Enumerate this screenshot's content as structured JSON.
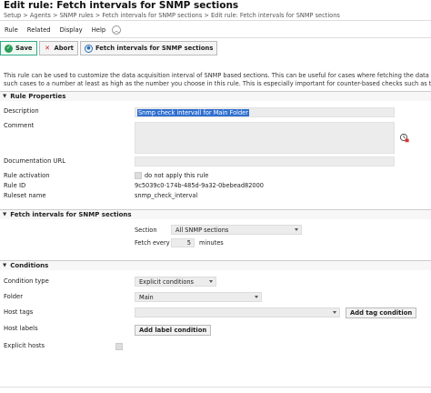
{
  "page": {
    "title": "Edit rule: Fetch intervals for SNMP sections",
    "breadcrumb": "Setup > Agents > SNMP rules > Fetch intervals for SNMP sections > Edit rule: Fetch intervals for SNMP sections"
  },
  "menu": {
    "items": [
      "Rule",
      "Related",
      "Display",
      "Help"
    ],
    "toggle_icon": "chevron-up-icon"
  },
  "toolbar": {
    "save_label": "Save",
    "abort_label": "Abort",
    "fetch_label": "Fetch intervals for SNMP sections"
  },
  "intro": {
    "line1": "This rule can be used to customize the data acquisition interval of SNMP based sections. This can be useful for cases where fetching the data takes",
    "line2": "such cases to a number at least as high as the number you choose in this rule. This is especially important for counter-based checks such as the"
  },
  "rule_properties": {
    "heading": "Rule Properties",
    "description_label": "Description",
    "description_value": "Snmp check intervall for Main Folder",
    "comment_label": "Comment",
    "comment_value": "",
    "doc_url_label": "Documentation URL",
    "doc_url_value": "",
    "activation_label": "Rule activation",
    "activation_text": "do not apply this rule",
    "rule_id_label": "Rule ID",
    "rule_id_value": "9c5039c0-174b-485d-9a32-0bebead82000",
    "ruleset_label": "Ruleset name",
    "ruleset_value": "snmp_check_interval"
  },
  "fetch_intervals": {
    "heading": "Fetch intervals for SNMP sections",
    "section_label": "Section",
    "section_value": "All SNMP sections",
    "fetch_every_label": "Fetch every",
    "fetch_every_value": "5",
    "fetch_every_unit": "minutes"
  },
  "conditions": {
    "heading": "Conditions",
    "condition_type_label": "Condition type",
    "condition_type_value": "Explicit conditions",
    "folder_label": "Folder",
    "folder_value": "Main",
    "host_tags_label": "Host tags",
    "host_tags_value": "",
    "add_tag_label": "Add tag condition",
    "host_labels_label": "Host labels",
    "add_label_label": "Add label condition",
    "explicit_hosts_label": "Explicit hosts"
  },
  "colors": {
    "field_bg": "#ececec",
    "selection": "#2f6fd0",
    "save_icon": "#2c9c5a",
    "abort_icon": "#cc2222",
    "fetch_icon": "#2b6fb7"
  }
}
